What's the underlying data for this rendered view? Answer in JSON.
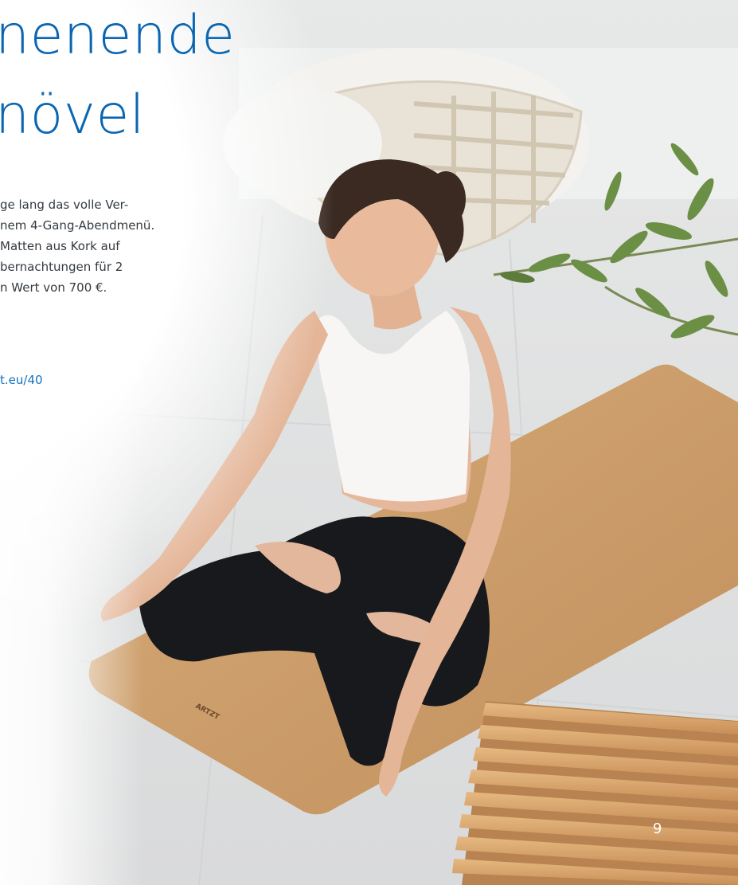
{
  "headline": {
    "line1": "nenende",
    "line2": "növel"
  },
  "body": {
    "lines": [
      "ge lang das volle Ver-",
      "nem 4-Gang-Abendmenü.",
      "Matten aus Kork auf",
      "bernachtungen für 2",
      "n Wert von 700 €."
    ]
  },
  "link": {
    "text": "t.eu/40"
  },
  "mat_brand": "ARTZT",
  "page_number": "9",
  "colors": {
    "accent_blue": "#0a66b2",
    "cork": "#c99e6b",
    "text": "#333a40"
  }
}
